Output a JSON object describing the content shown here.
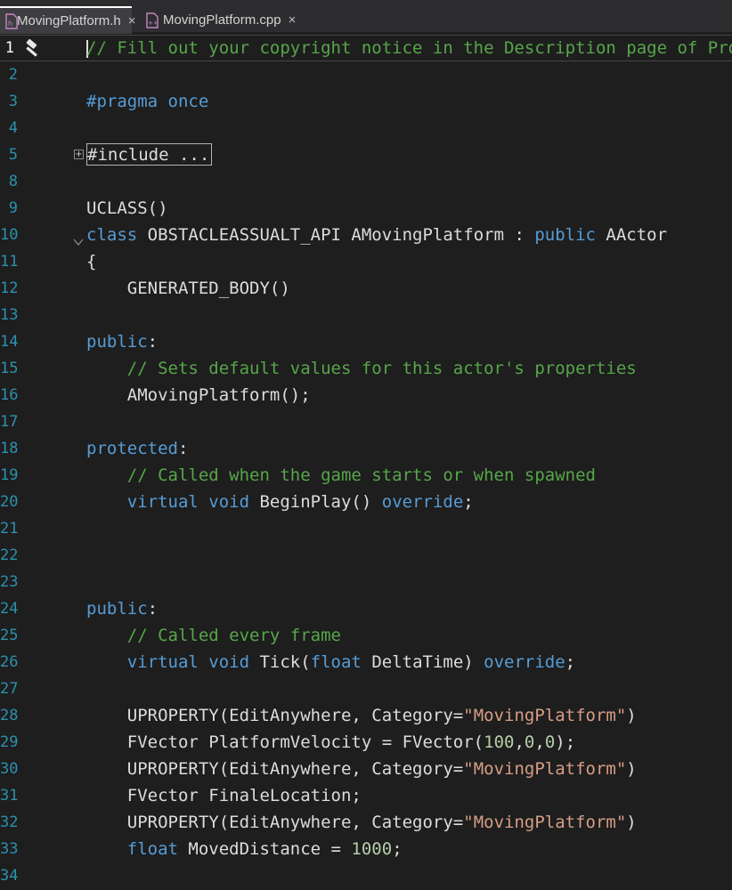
{
  "tabs": [
    {
      "label": "MovingPlatform.h",
      "active": true,
      "close": "×"
    },
    {
      "label": "MovingPlatform.cpp",
      "active": false,
      "close": "×"
    }
  ],
  "colors": {
    "comment": "#57a64a",
    "keyword": "#569cd6",
    "string": "#d69d85",
    "number": "#b5cea8",
    "plain": "#dcdcdc",
    "line_number": "#2b91af"
  },
  "icons": {
    "gutter": "hammer-icon",
    "tab_file": "cpp-file-icon"
  },
  "lines": [
    {
      "n": "1",
      "parts": [
        {
          "t": "// Fill out your copyright notice in the Description page of Proj",
          "c": "comment"
        }
      ]
    },
    {
      "n": "2",
      "parts": []
    },
    {
      "n": "3",
      "parts": [
        {
          "t": "#pragma once",
          "c": "keyword"
        }
      ]
    },
    {
      "n": "4",
      "parts": []
    },
    {
      "n": "5",
      "parts": [
        {
          "t": "#include ...",
          "c": "plain",
          "box": true
        }
      ],
      "fold": "collapsed"
    },
    {
      "n": "8",
      "parts": []
    },
    {
      "n": "9",
      "parts": [
        {
          "t": "UCLASS()",
          "c": "plain"
        }
      ]
    },
    {
      "n": "10",
      "parts": [
        {
          "t": "class",
          "c": "keyword"
        },
        {
          "t": " OBSTACLEASSUALT_API AMovingPlatform : ",
          "c": "plain"
        },
        {
          "t": "public",
          "c": "keyword"
        },
        {
          "t": " AActor",
          "c": "plain"
        }
      ],
      "fold": "open"
    },
    {
      "n": "11",
      "parts": [
        {
          "t": "{",
          "c": "plain"
        }
      ]
    },
    {
      "n": "12",
      "parts": [
        {
          "t": "    GENERATED_BODY()",
          "c": "plain"
        }
      ]
    },
    {
      "n": "13",
      "parts": []
    },
    {
      "n": "14",
      "parts": [
        {
          "t": "public",
          "c": "keyword"
        },
        {
          "t": ":",
          "c": "plain"
        }
      ]
    },
    {
      "n": "15",
      "parts": [
        {
          "t": "    // Sets default values for this actor's properties",
          "c": "comment"
        }
      ]
    },
    {
      "n": "16",
      "parts": [
        {
          "t": "    AMovingPlatform();",
          "c": "plain"
        }
      ]
    },
    {
      "n": "17",
      "parts": []
    },
    {
      "n": "18",
      "parts": [
        {
          "t": "protected",
          "c": "keyword"
        },
        {
          "t": ":",
          "c": "plain"
        }
      ]
    },
    {
      "n": "19",
      "parts": [
        {
          "t": "    // Called when the game starts or when spawned",
          "c": "comment"
        }
      ]
    },
    {
      "n": "20",
      "parts": [
        {
          "t": "    virtual void",
          "c": "keyword"
        },
        {
          "t": " BeginPlay() ",
          "c": "plain"
        },
        {
          "t": "override",
          "c": "keyword"
        },
        {
          "t": ";",
          "c": "plain"
        }
      ]
    },
    {
      "n": "21",
      "parts": []
    },
    {
      "n": "22",
      "parts": []
    },
    {
      "n": "23",
      "parts": []
    },
    {
      "n": "24",
      "parts": [
        {
          "t": "public",
          "c": "keyword"
        },
        {
          "t": ":",
          "c": "plain"
        }
      ]
    },
    {
      "n": "25",
      "parts": [
        {
          "t": "    // Called every frame",
          "c": "comment"
        }
      ]
    },
    {
      "n": "26",
      "parts": [
        {
          "t": "    virtual void",
          "c": "keyword"
        },
        {
          "t": " Tick(",
          "c": "plain"
        },
        {
          "t": "float",
          "c": "keyword"
        },
        {
          "t": " DeltaTime) ",
          "c": "plain"
        },
        {
          "t": "override",
          "c": "keyword"
        },
        {
          "t": ";",
          "c": "plain"
        }
      ]
    },
    {
      "n": "27",
      "parts": []
    },
    {
      "n": "28",
      "parts": [
        {
          "t": "    UPROPERTY(EditAnywhere, Category=",
          "c": "plain"
        },
        {
          "t": "\"MovingPlatform\"",
          "c": "string"
        },
        {
          "t": ")",
          "c": "plain"
        }
      ]
    },
    {
      "n": "29",
      "parts": [
        {
          "t": "    FVector PlatformVelocity = FVector(",
          "c": "plain"
        },
        {
          "t": "100",
          "c": "number"
        },
        {
          "t": ",",
          "c": "plain"
        },
        {
          "t": "0",
          "c": "number"
        },
        {
          "t": ",",
          "c": "plain"
        },
        {
          "t": "0",
          "c": "number"
        },
        {
          "t": ");",
          "c": "plain"
        }
      ]
    },
    {
      "n": "30",
      "parts": [
        {
          "t": "    UPROPERTY(EditAnywhere, Category=",
          "c": "plain"
        },
        {
          "t": "\"MovingPlatform\"",
          "c": "string"
        },
        {
          "t": ")",
          "c": "plain"
        }
      ]
    },
    {
      "n": "31",
      "parts": [
        {
          "t": "    FVector FinaleLocation;",
          "c": "plain"
        }
      ]
    },
    {
      "n": "32",
      "parts": [
        {
          "t": "    UPROPERTY(EditAnywhere, Category=",
          "c": "plain"
        },
        {
          "t": "\"MovingPlatform\"",
          "c": "string"
        },
        {
          "t": ")",
          "c": "plain"
        }
      ]
    },
    {
      "n": "33",
      "parts": [
        {
          "t": "    float",
          "c": "keyword"
        },
        {
          "t": " MovedDistance = ",
          "c": "plain"
        },
        {
          "t": "1000",
          "c": "number"
        },
        {
          "t": ";",
          "c": "plain"
        }
      ]
    },
    {
      "n": "34",
      "parts": []
    }
  ]
}
